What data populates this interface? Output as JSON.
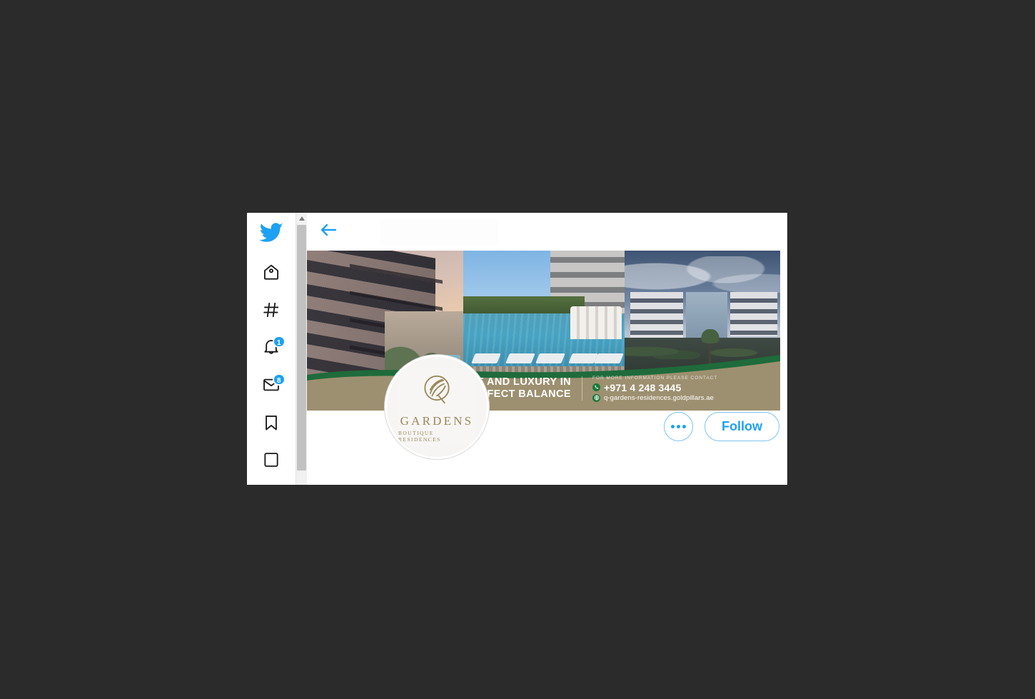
{
  "app": {
    "name": "Twitter",
    "logo_icon": "twitter-bird-icon"
  },
  "sidebar": {
    "items": [
      {
        "key": "home",
        "icon": "home-icon",
        "badge": null
      },
      {
        "key": "explore",
        "icon": "hashtag-icon",
        "badge": null
      },
      {
        "key": "notifications",
        "icon": "bell-icon",
        "badge": "1"
      },
      {
        "key": "messages",
        "icon": "envelope-icon",
        "badge": "8"
      },
      {
        "key": "bookmarks",
        "icon": "bookmark-icon",
        "badge": null
      },
      {
        "key": "lists",
        "icon": "list-icon",
        "badge": null
      }
    ]
  },
  "scrollbar": {
    "up_arrow_icon": "scroll-up-arrow-icon",
    "thumb": "scroll-thumb"
  },
  "topbar": {
    "back_icon": "back-arrow-icon"
  },
  "banner": {
    "photos": [
      {
        "key": "facade",
        "alt": "apartment-facade-dusk"
      },
      {
        "key": "pool",
        "alt": "swimming-pool-loungers"
      },
      {
        "key": "exterior",
        "alt": "residences-exterior-dusk"
      }
    ],
    "wave_color": "#1f6b3b",
    "band_color": "#9d9070",
    "tagline_line1": "LIFE AND LUXURY IN",
    "tagline_line2": "PERFECT BALANCE",
    "contact_label": "FOR MORE INFORMATION PLEASE CONTACT",
    "phone": "+971 4 248 3445",
    "website": "q-gardens-residences.goldpillars.ae",
    "phone_icon": "phone-icon",
    "globe_icon": "globe-icon"
  },
  "avatar": {
    "monogram_icon": "q-monogram-icon",
    "name": "GARDENS",
    "subtitle": "BOUTIQUE RESIDENCES",
    "gold_color": "#9a8759"
  },
  "actions": {
    "more_icon": "more-options-icon",
    "follow_label": "Follow",
    "accent_color": "#1da1f2"
  }
}
